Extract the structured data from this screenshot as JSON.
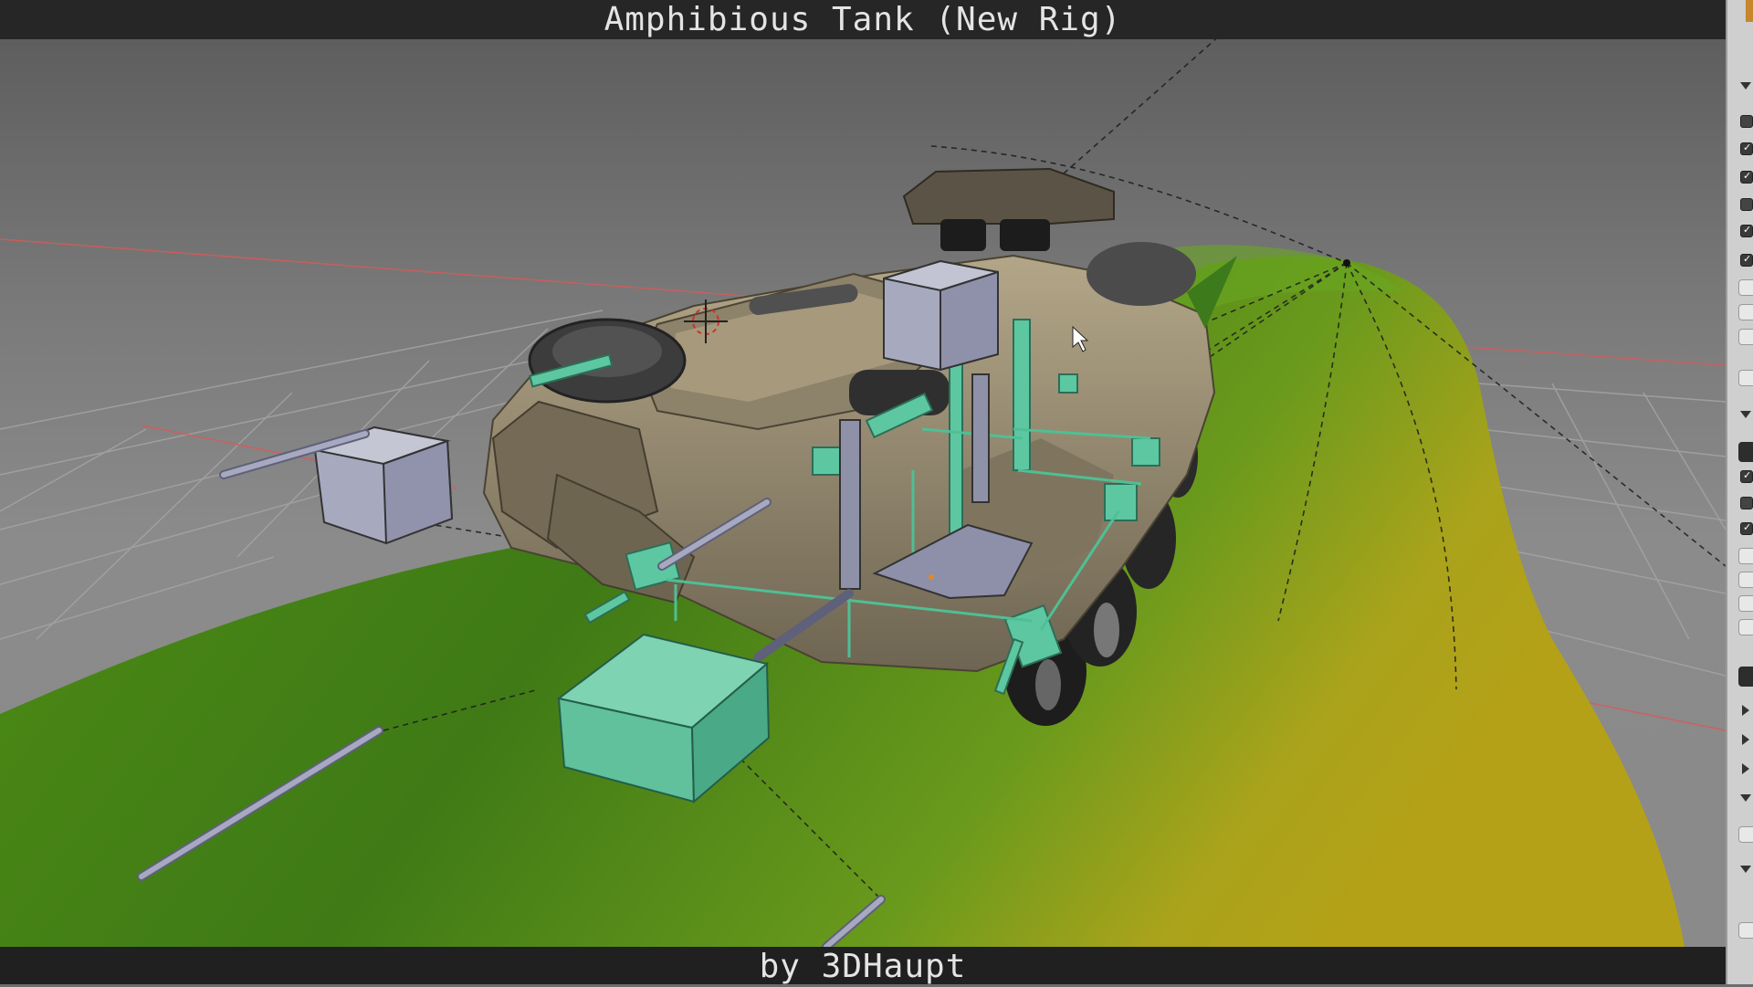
{
  "title": "Amphibious Tank (New Rig)",
  "credit": "by 3DHaupt",
  "colors": {
    "terrain_green": "#5f9b1e",
    "terrain_yellow": "#a9a31b",
    "control_mint": "#54bf9a",
    "control_gray": "#a9a9c2",
    "tank_khaki": "#9b8f72",
    "axis_red": "#d94848"
  },
  "icons": {
    "cursor": "3d-cursor-icon",
    "pointer": "mouse-pointer-icon"
  }
}
